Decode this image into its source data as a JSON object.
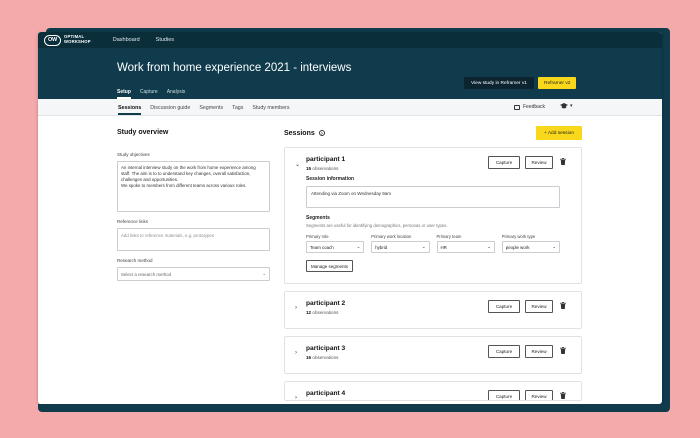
{
  "app": {
    "logo_mark": "OW",
    "logo_line1": "OPTIMAL",
    "logo_line2": "WORKSHOP",
    "nav": [
      "Dashboard",
      "Studies"
    ]
  },
  "header": {
    "title": "Work from home experience 2021 - interviews",
    "view_btn": "View study in Reframer v1",
    "reframer_btn": "Reframer v2",
    "tabs": [
      "Setup",
      "Capture",
      "Analysis"
    ],
    "active_tab": "Setup"
  },
  "subnav": {
    "tabs": [
      "Sessions",
      "Discussion guide",
      "Segments",
      "Tags",
      "Study members"
    ],
    "active": "Sessions",
    "feedback": "Feedback"
  },
  "overview": {
    "title": "Study overview",
    "objectives_label": "Study objectives",
    "objectives_text": "An internal interview study on the work from home experience among staff. The aim is to to understand key changes, overall satisfaction, challenges and opportunities.",
    "objectives_text2": "We spoke to members from different teams across various roles.",
    "reference_label": "Reference links",
    "reference_placeholder": "Add links to reference materials, e.g. prototypes",
    "method_label": "Research method",
    "method_placeholder": "Select a research method"
  },
  "sessions": {
    "title": "Sessions",
    "add_btn": "+ Add session",
    "capture_label": "Capture",
    "review_label": "Review",
    "obs_suffix": "observations",
    "list": [
      {
        "name": "participant 1",
        "obs": "15"
      },
      {
        "name": "participant 2",
        "obs": "12"
      },
      {
        "name": "participant 3",
        "obs": "16"
      },
      {
        "name": "participant 4",
        "obs": "16"
      }
    ],
    "info_label": "Session information",
    "info_text": "Attending via Zoom on Wednesday 9am",
    "segments_label": "Segments",
    "segments_desc": "Segments are useful for identifying demographics, personas or user types.",
    "segments": [
      {
        "label": "Primary role",
        "value": "Team coach"
      },
      {
        "label": "Primary work location",
        "value": "hybrid"
      },
      {
        "label": "Primary team",
        "value": "HR"
      },
      {
        "label": "Primary work type",
        "value": "people work"
      }
    ],
    "manage_btn": "Manage segments"
  },
  "icons": {
    "chevron": "chevron-down-icon",
    "trash": "trash-icon",
    "info": "info-icon",
    "feedback": "feedback-icon",
    "help": "graduation-cap-icon"
  }
}
